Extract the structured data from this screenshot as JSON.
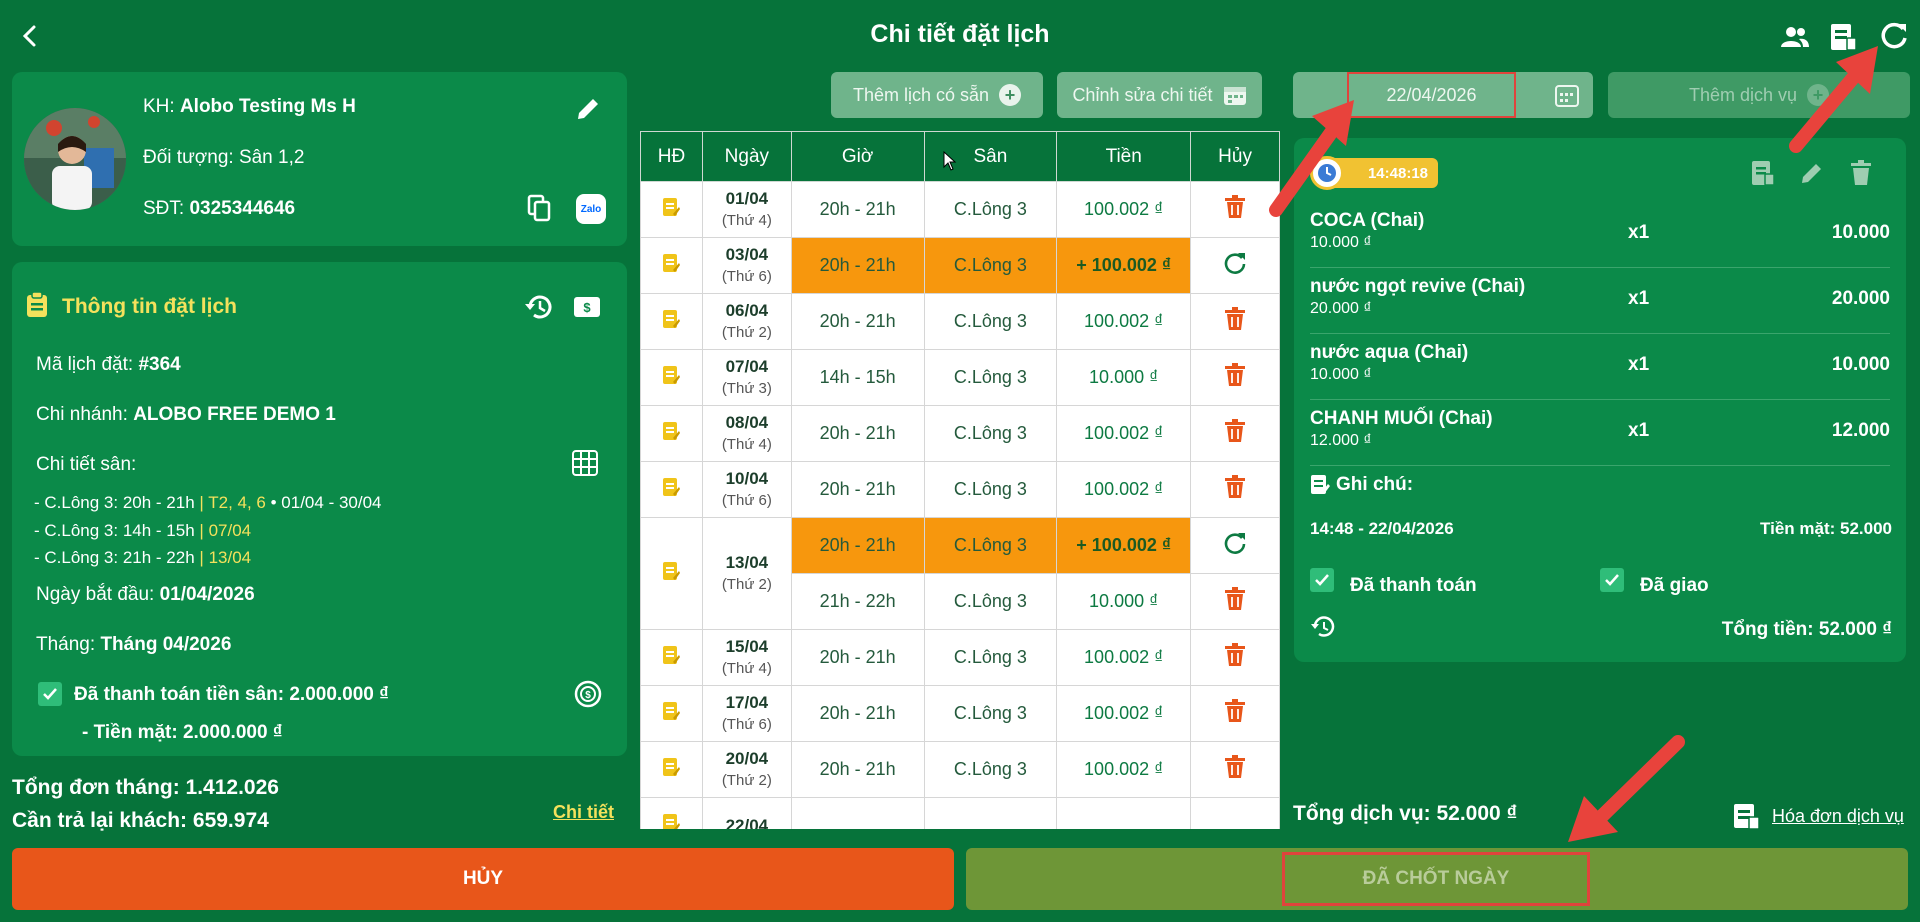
{
  "header": {
    "title": "Chi tiết đặt lịch"
  },
  "customer": {
    "name_label": "KH: ",
    "name": "Alobo Testing Ms H",
    "target_label": "Đối tượng: ",
    "target": "Sân 1,2",
    "phone_label": "SĐT: ",
    "phone": "0325344646",
    "zalo": "Zalo"
  },
  "booking": {
    "section_title": "Thông tin đặt lịch",
    "code_label": "Mã lịch đặt: ",
    "code": "#364",
    "branch_label": "Chi nhánh: ",
    "branch": "ALOBO FREE DEMO 1",
    "detail_label": "Chi tiết sân:",
    "details": [
      {
        "court": "- C.Lông 3: 20h - 21h",
        "sep": "|",
        "days": "T2, 4, 6",
        "range": "• 01/04 - 30/04"
      },
      {
        "court": "- C.Lông 3: 14h - 15h",
        "sep": "|",
        "days": "07/04",
        "range": ""
      },
      {
        "court": "- C.Lông 3: 21h - 22h",
        "sep": "|",
        "days": "13/04",
        "range": ""
      }
    ],
    "start_label": "Ngày bắt đầu: ",
    "start": "01/04/2026",
    "month_label": "Tháng: ",
    "month": "Tháng 04/2026",
    "paid_label": "Đã thanh toán tiền sân: 2.000.000 ₫",
    "cash_label": "- Tiền mặt: 2.000.000 ₫"
  },
  "summary": {
    "total_month": "Tổng đơn tháng: 1.412.026",
    "refund": "Cần trả lại khách: 659.974",
    "detail_link": "Chi tiết"
  },
  "toolbar": {
    "add_schedule": "Thêm lịch có sẵn",
    "edit_detail": "Chỉnh sửa chi tiết",
    "date": "22/04/2026",
    "add_service": "Thêm dịch vụ"
  },
  "table": {
    "headers": [
      "HĐ",
      "Ngày",
      "Giờ",
      "Sân",
      "Tiền",
      "Hủy"
    ],
    "rows": [
      {
        "date": "01/04",
        "dow": "(Thứ 4)",
        "time": "20h - 21h",
        "court": "C.Lông 3",
        "price": "100.002 ₫"
      },
      {
        "date": "03/04",
        "dow": "(Thứ 6)",
        "time": "20h - 21h",
        "court": "C.Lông 3",
        "price": "+ 100.002 ₫"
      },
      {
        "date": "06/04",
        "dow": "(Thứ 2)",
        "time": "20h - 21h",
        "court": "C.Lông 3",
        "price": "100.002 ₫"
      },
      {
        "date": "07/04",
        "dow": "(Thứ 3)",
        "time": "14h - 15h",
        "court": "C.Lông 3",
        "price": "10.000 ₫"
      },
      {
        "date": "08/04",
        "dow": "(Thứ 4)",
        "time": "20h - 21h",
        "court": "C.Lông 3",
        "price": "100.002 ₫"
      },
      {
        "date": "10/04",
        "dow": "(Thứ 6)",
        "time": "20h - 21h",
        "court": "C.Lông 3",
        "price": "100.002 ₫"
      },
      {
        "date": "13/04",
        "dow": "(Thứ 2)",
        "time": "20h - 21h",
        "court": "C.Lông 3",
        "price": "+ 100.002 ₫"
      },
      {
        "date": "",
        "dow": "",
        "time": "21h - 22h",
        "court": "C.Lông 3",
        "price": "10.000 ₫"
      },
      {
        "date": "15/04",
        "dow": "(Thứ 4)",
        "time": "20h - 21h",
        "court": "C.Lông 3",
        "price": "100.002 ₫"
      },
      {
        "date": "17/04",
        "dow": "(Thứ 6)",
        "time": "20h - 21h",
        "court": "C.Lông 3",
        "price": "100.002 ₫"
      },
      {
        "date": "20/04",
        "dow": "(Thứ 2)",
        "time": "20h - 21h",
        "court": "C.Lông 3",
        "price": "100.002 ₫"
      },
      {
        "date": "22/04",
        "dow": "",
        "time": "",
        "court": "",
        "price": ""
      }
    ]
  },
  "service_card": {
    "time_badge": "14:48:18",
    "items": [
      {
        "name": "COCA (Chai)",
        "unit_price": "10.000 ₫",
        "qty": "x1",
        "total": "10.000"
      },
      {
        "name": "nước ngọt revive (Chai)",
        "unit_price": "20.000 ₫",
        "qty": "x1",
        "total": "20.000"
      },
      {
        "name": "nước aqua (Chai)",
        "unit_price": "10.000 ₫",
        "qty": "x1",
        "total": "10.000"
      },
      {
        "name": "CHANH MUỐI (Chai)",
        "unit_price": "12.000 ₫",
        "qty": "x1",
        "total": "12.000"
      }
    ],
    "note_label": "Ghi chú:",
    "timestamp": "14:48 - 22/04/2026",
    "cash": "Tiền mặt: 52.000",
    "paid": "Đã thanh toán",
    "delivered": "Đã giao",
    "total": "Tổng tiền: 52.000 ₫"
  },
  "services_total": "Tổng dịch vụ: 52.000 ₫",
  "service_invoice": "Hóa đơn dịch vụ",
  "footer": {
    "cancel": "HỦY",
    "closed": "ĐÃ CHỐT NGÀY"
  },
  "colors": {
    "bg": "#06733a",
    "panel": "#0b8a49",
    "orange": "#f7970d",
    "cancel": "#e8561a",
    "closed": "#6e9637",
    "highlight_border": "#e0443c"
  }
}
